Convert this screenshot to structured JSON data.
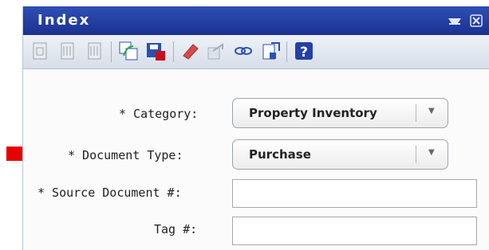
{
  "window": {
    "title": "Index"
  },
  "toolbar": {
    "buttons": [
      "page-icon",
      "document-ruler-icon",
      "document-ruler-icon",
      "refresh-icon",
      "save-icon",
      "eraser-icon",
      "share-icon",
      "link-icon",
      "export-icon",
      "help-icon"
    ],
    "help_label": "?"
  },
  "form": {
    "category": {
      "label": "* Category:",
      "value": "Property Inventory"
    },
    "document_type": {
      "label": "* Document Type:",
      "value": "Purchase"
    },
    "source_document": {
      "label": "* Source Document #:",
      "value": ""
    },
    "tag": {
      "label": "Tag #:",
      "value": ""
    }
  },
  "colors": {
    "titlebar": "#1f3a9e",
    "arrow": "#e60000"
  }
}
